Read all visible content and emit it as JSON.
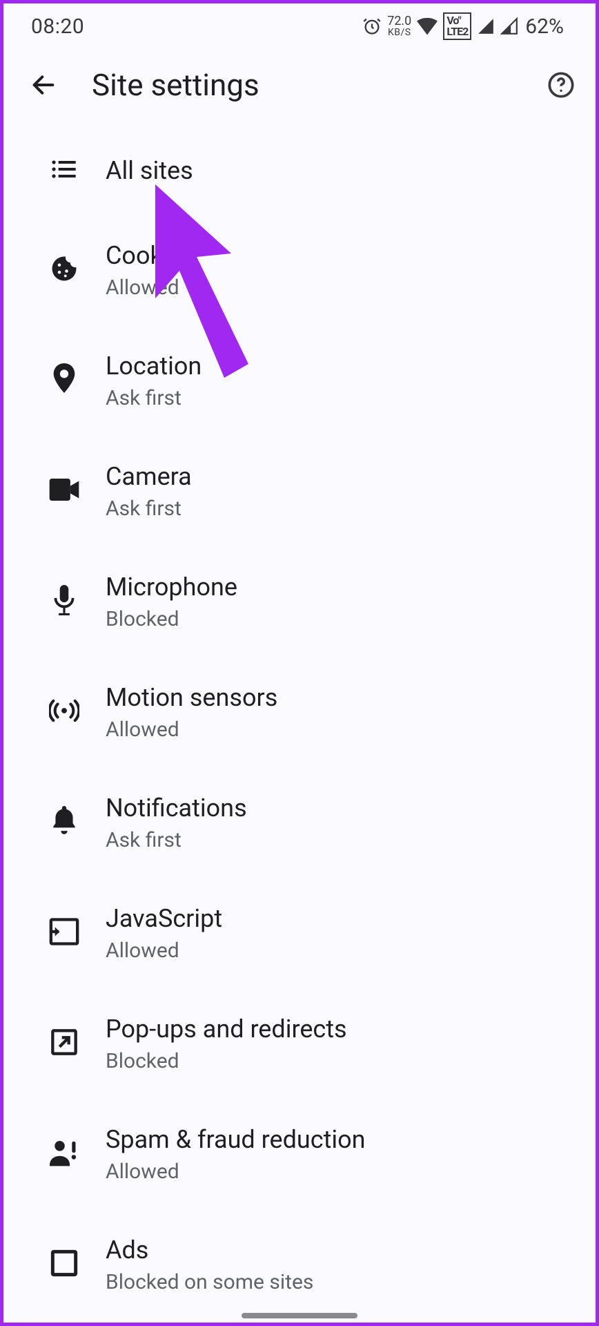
{
  "status": {
    "time": "08:20",
    "net_speed_top": "72.0",
    "net_speed_bot": "KB/S",
    "volte": "Vo\" LTE2",
    "battery": "62%"
  },
  "header": {
    "title": "Site settings"
  },
  "items": [
    {
      "label": "All sites",
      "status": ""
    },
    {
      "label": "Cookies",
      "status": "Allowed"
    },
    {
      "label": "Location",
      "status": "Ask first"
    },
    {
      "label": "Camera",
      "status": "Ask first"
    },
    {
      "label": "Microphone",
      "status": "Blocked"
    },
    {
      "label": "Motion sensors",
      "status": "Allowed"
    },
    {
      "label": "Notifications",
      "status": "Ask first"
    },
    {
      "label": "JavaScript",
      "status": "Allowed"
    },
    {
      "label": "Pop-ups and redirects",
      "status": "Blocked"
    },
    {
      "label": "Spam & fraud reduction",
      "status": "Allowed"
    },
    {
      "label": "Ads",
      "status": "Blocked on some sites"
    }
  ]
}
